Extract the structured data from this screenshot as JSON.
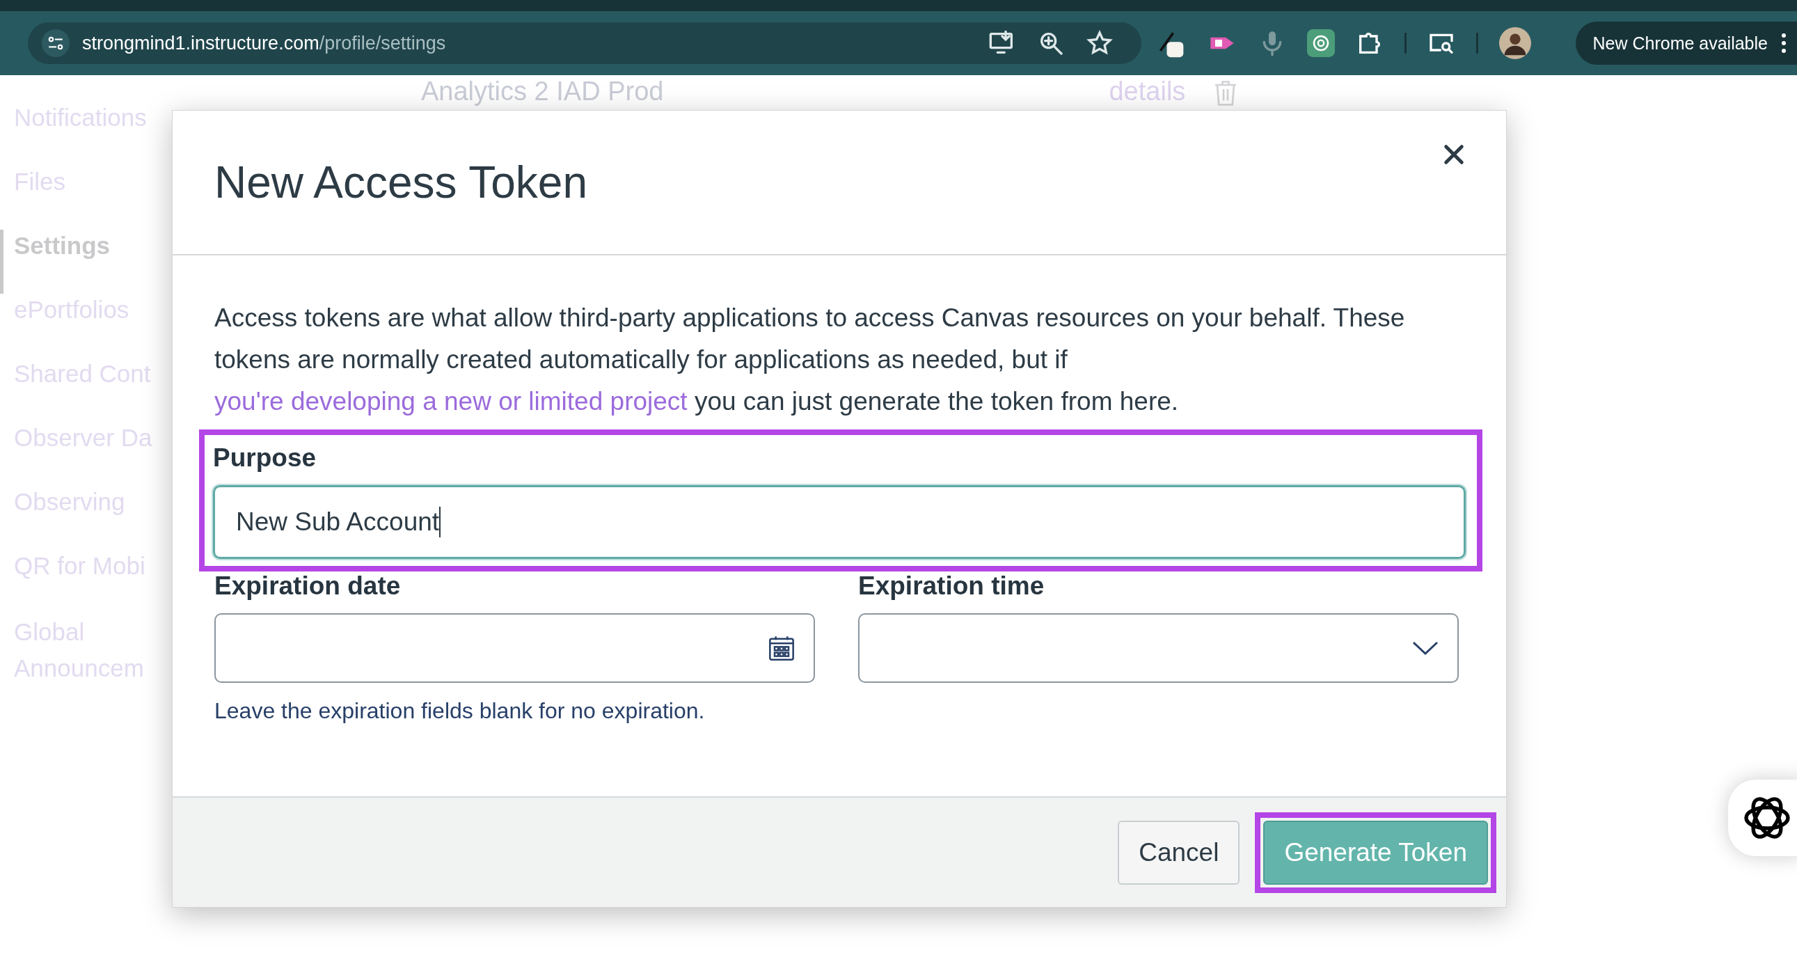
{
  "browser": {
    "url_host": "strongmind1.instructure.com",
    "url_path": "/profile/settings",
    "update_label": "New Chrome available"
  },
  "sidebar": {
    "items": [
      {
        "label": "Notifications",
        "selected": false
      },
      {
        "label": "Files",
        "selected": false
      },
      {
        "label": "Settings",
        "selected": true
      },
      {
        "label": "ePortfolios",
        "selected": false
      },
      {
        "label": "Shared Cont",
        "selected": false
      },
      {
        "label": "Observer Da",
        "selected": false
      },
      {
        "label": "Observing",
        "selected": false
      },
      {
        "label": "QR for Mobi",
        "selected": false
      },
      {
        "label": "Global Announcem",
        "selected": false
      }
    ]
  },
  "background": {
    "token_name": "Analytics 2 IAD Prod",
    "details_link": "details"
  },
  "dialog": {
    "title": "New Access Token",
    "intro_before": "Access tokens are what allow third-party applications to access Canvas resources on your behalf. These tokens are normally created automatically for applications as needed, but if ",
    "intro_link": "you're developing a new or limited project",
    "intro_after": " you can just generate the token from here.",
    "purpose": {
      "label": "Purpose",
      "value": "New Sub Account",
      "highlighted": true
    },
    "expiration_date": {
      "label": "Expiration date"
    },
    "expiration_time": {
      "label": "Expiration time"
    },
    "hint": "Leave the expiration fields blank for no expiration.",
    "buttons": [
      {
        "label": "Cancel",
        "kind": "secondary",
        "highlighted": false
      },
      {
        "label": "Generate Token",
        "kind": "primary",
        "highlighted": true
      }
    ]
  }
}
